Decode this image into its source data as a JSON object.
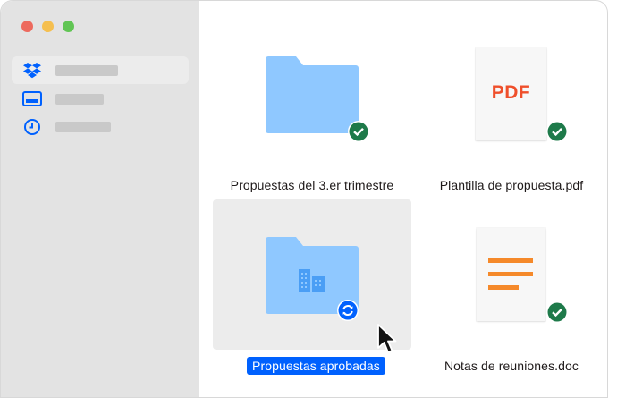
{
  "window": {
    "traffic_lights": {
      "red": "#ed6a5e",
      "yellow": "#f5bf4f",
      "green": "#61c554"
    }
  },
  "sidebar": {
    "items": [
      {
        "icon": "dropbox-icon",
        "label": "",
        "selected": true
      },
      {
        "icon": "photos-icon",
        "label": "",
        "selected": false
      },
      {
        "icon": "recents-icon",
        "label": "",
        "selected": false
      }
    ]
  },
  "files": [
    {
      "name": "Propuestas del 3.er trimestre",
      "type": "folder",
      "status": "synced"
    },
    {
      "name": "Plantilla de propuesta.pdf",
      "type": "pdf",
      "thumbnail_text": "PDF",
      "status": "synced"
    },
    {
      "name": "Propuestas aprobadas",
      "type": "team-folder",
      "status": "syncing",
      "selected": true
    },
    {
      "name": "Notas de reuniones.doc",
      "type": "doc",
      "status": "synced"
    }
  ],
  "colors": {
    "accent": "#0061fe",
    "folder": "#8fc8ff",
    "synced": "#1e7a4a",
    "pdf": "#ef4f2b",
    "doc_lines": "#f5892a"
  }
}
